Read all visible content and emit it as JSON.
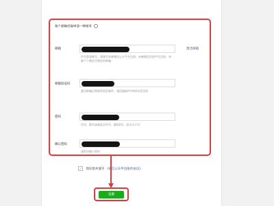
{
  "form": {
    "tip": "每个邮箱仅能申请一种帐号",
    "fields": [
      {
        "label": "邮箱",
        "help": "作为登录帐号，请填写未被微信公众平台注册，未被微信开放平台注册，未被个人微信号绑定的邮箱"
      },
      {
        "label": "邮箱验证码",
        "help": "激活邮箱后将收到验证邮件，请回填邮件中的6位验证码"
      },
      {
        "label": "密码",
        "help": "字母、数字或者英文符号，最短8位，区分大小写"
      },
      {
        "label": "确认密码",
        "help": "请再次输入密码"
      }
    ],
    "activate_link": "激活邮箱",
    "agree_prefix": "我同意并遵守",
    "agree_protocol": "《微信公众平台服务协议》",
    "submit_label": "注册"
  },
  "colors": {
    "highlight": "#e0383e",
    "primary_green": "#1aad19",
    "link": "#576b95",
    "redaction": "#141414"
  }
}
